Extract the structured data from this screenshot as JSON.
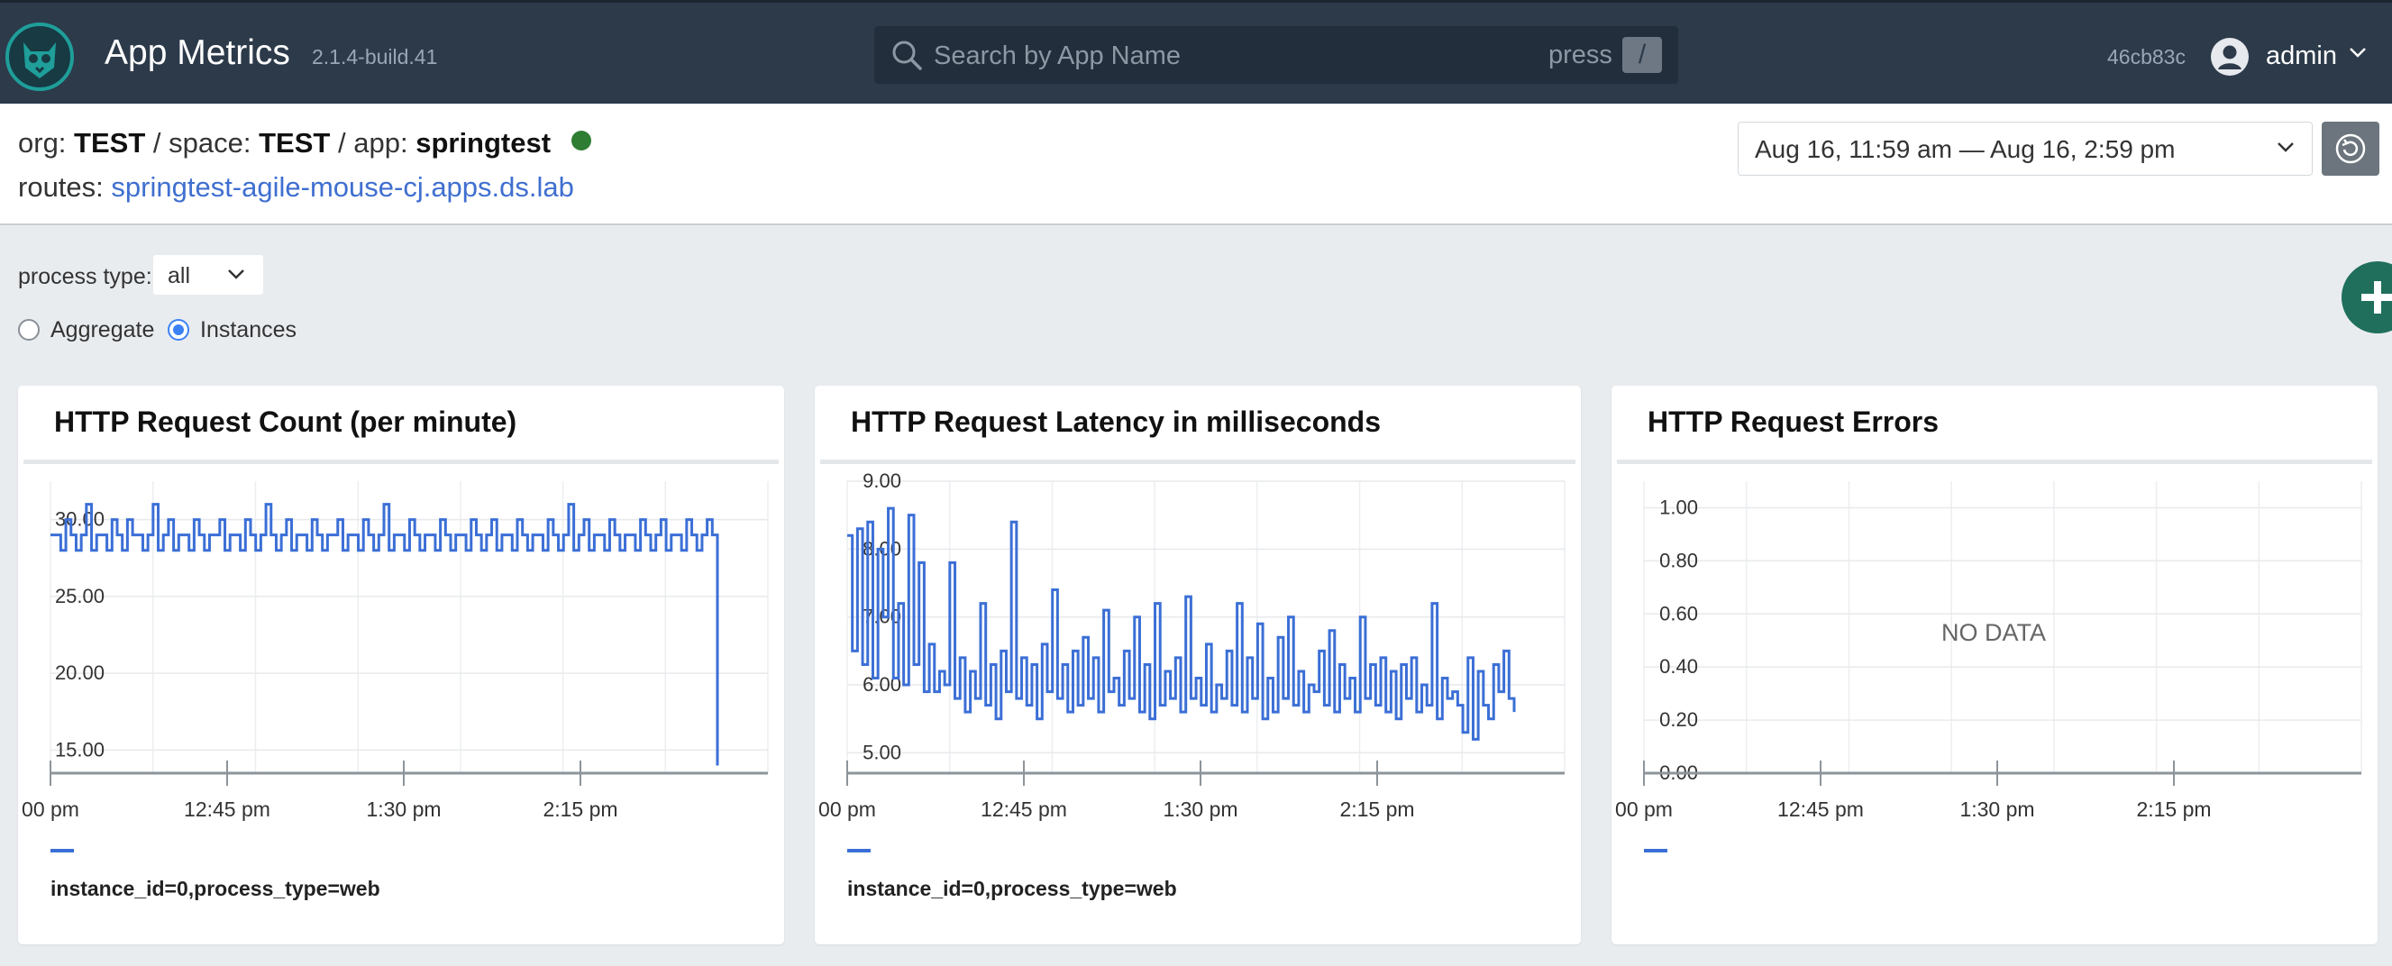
{
  "header": {
    "app_title": "App Metrics",
    "version": "2.1.4-build.41",
    "search_placeholder": "Search by App Name",
    "press_text": "press",
    "shortcut_key": "/",
    "build_hash": "46cb83c",
    "user": "admin"
  },
  "context": {
    "org_label": "org:",
    "org": "TEST",
    "space_label": "space:",
    "space": "TEST",
    "app_label": "app:",
    "app": "springtest",
    "separator": "/",
    "routes_label": "routes:",
    "route": "springtest-agile-mouse-cj.apps.ds.lab",
    "status_color": "#2e7d32",
    "time_range": "Aug 16, 11:59 am — Aug 16, 2:59 pm"
  },
  "controls": {
    "process_type_label": "process type:",
    "process_type_value": "all",
    "radio_aggregate": "Aggregate",
    "radio_instances": "Instances",
    "selected_mode": "Instances"
  },
  "colors": {
    "accent": "#3b6fd6",
    "topbar": "#2c3a4a",
    "add_button": "#1f6f5c"
  },
  "chart_data": [
    {
      "type": "line",
      "title": "HTTP Request Count (per minute)",
      "x_ticks": [
        "00 pm",
        "12:45 pm",
        "1:30 pm",
        "2:15 pm"
      ],
      "y_ticks": [
        "15.00",
        "20.00",
        "25.00",
        "30.00"
      ],
      "ylim": [
        13.5,
        32.5
      ],
      "legend_entry": "instance_id=0,process_type=web",
      "series": [
        {
          "name": "instance_id=0,process_type=web",
          "values": [
            29,
            29,
            28,
            30,
            29,
            28,
            29,
            31,
            28,
            29,
            29,
            28,
            30,
            29,
            28,
            30,
            29,
            29,
            28,
            29,
            31,
            28,
            29,
            30,
            28,
            29,
            29,
            28,
            30,
            29,
            28,
            29,
            29,
            30,
            28,
            29,
            29,
            28,
            30,
            29,
            28,
            29,
            31,
            29,
            28,
            29,
            30,
            28,
            29,
            29,
            28,
            30,
            29,
            28,
            29,
            29,
            30,
            28,
            29,
            29,
            28,
            30,
            29,
            28,
            29,
            31,
            28,
            29,
            29,
            28,
            30,
            29,
            28,
            29,
            29,
            28,
            30,
            29,
            28,
            29,
            29,
            28,
            30,
            29,
            28,
            29,
            30,
            28,
            29,
            29,
            28,
            30,
            29,
            28,
            29,
            29,
            28,
            30,
            29,
            28,
            29,
            31,
            28,
            29,
            30,
            28,
            29,
            29,
            28,
            30,
            29,
            28,
            29,
            29,
            28,
            30,
            29,
            28,
            29,
            30,
            28,
            29,
            29,
            28,
            30,
            29,
            28,
            29,
            30,
            29,
            14
          ]
        }
      ]
    },
    {
      "type": "line",
      "title": "HTTP Request Latency in milliseconds",
      "x_ticks": [
        "00 pm",
        "12:45 pm",
        "1:30 pm",
        "2:15 pm"
      ],
      "y_ticks": [
        "5.00",
        "6.00",
        "7.00",
        "8.00",
        "9.00"
      ],
      "ylim": [
        4.7,
        9.0
      ],
      "legend_entry": "instance_id=0,process_type=web",
      "series": [
        {
          "name": "instance_id=0,process_type=web",
          "values": [
            8.2,
            6.5,
            8.3,
            6.3,
            8.4,
            6.1,
            8.0,
            7.0,
            8.6,
            6.1,
            7.2,
            6.0,
            8.5,
            6.3,
            7.8,
            5.9,
            6.6,
            5.9,
            6.2,
            6.0,
            7.8,
            5.8,
            6.4,
            5.6,
            6.2,
            5.8,
            7.2,
            5.7,
            6.3,
            5.5,
            6.5,
            5.9,
            8.4,
            5.8,
            6.4,
            5.7,
            6.3,
            5.5,
            6.6,
            5.9,
            7.4,
            5.8,
            6.3,
            5.6,
            6.5,
            5.7,
            6.7,
            5.8,
            6.4,
            5.6,
            7.1,
            5.9,
            6.1,
            5.7,
            6.5,
            5.8,
            7.0,
            5.6,
            6.3,
            5.5,
            7.2,
            5.7,
            6.2,
            5.8,
            6.4,
            5.6,
            7.3,
            5.8,
            6.1,
            5.7,
            6.6,
            5.6,
            6.0,
            5.8,
            6.5,
            5.7,
            7.2,
            5.6,
            6.4,
            5.8,
            6.9,
            5.5,
            6.1,
            5.6,
            6.7,
            5.8,
            7.0,
            5.7,
            6.2,
            5.6,
            6.0,
            5.9,
            6.5,
            5.7,
            6.8,
            5.6,
            6.3,
            5.8,
            6.1,
            5.6,
            7.0,
            5.8,
            6.3,
            5.7,
            6.4,
            5.6,
            6.2,
            5.5,
            6.3,
            5.8,
            6.4,
            5.6,
            6.0,
            5.7,
            7.2,
            5.5,
            6.1,
            5.8,
            5.9,
            5.7,
            5.3,
            6.4,
            5.2,
            6.2,
            5.7,
            5.5,
            6.3,
            5.9,
            6.5,
            5.8,
            5.6
          ]
        }
      ]
    },
    {
      "type": "line",
      "title": "HTTP Request Errors",
      "x_ticks": [
        "00 pm",
        "12:45 pm",
        "1:30 pm",
        "2:15 pm"
      ],
      "y_ticks": [
        "0.00",
        "0.20",
        "0.40",
        "0.60",
        "0.80",
        "1.00"
      ],
      "ylim": [
        0,
        1.1
      ],
      "no_data_text": "NO DATA",
      "series": []
    }
  ]
}
